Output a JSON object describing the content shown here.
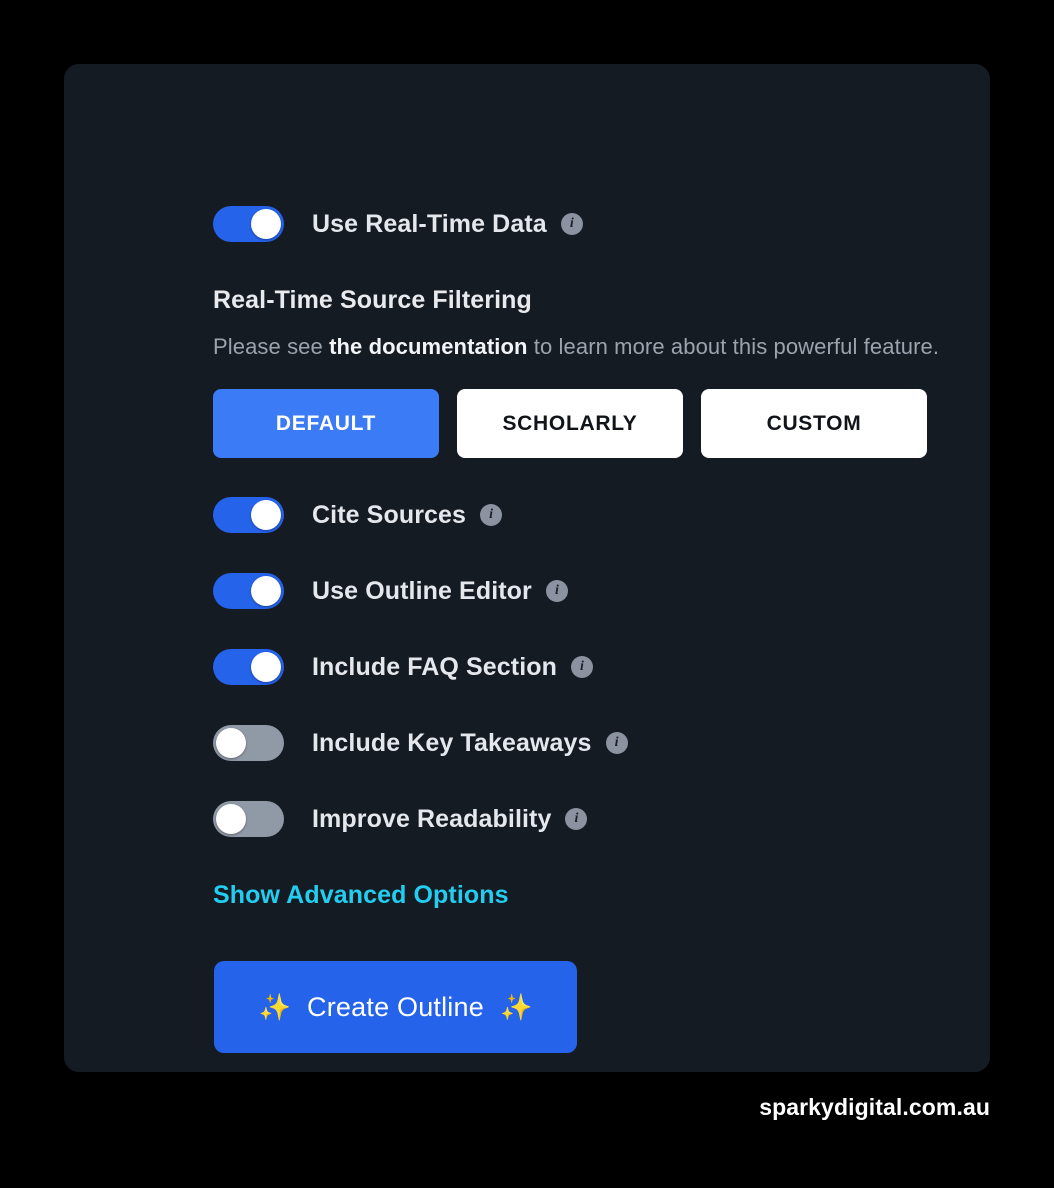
{
  "colors": {
    "page_background": "#000000",
    "card_background": "#141b22",
    "toggle_on": "#2563eb",
    "toggle_off": "#9099a6",
    "preset_active": "#3b7bf6",
    "advanced_link": "#22cdf0",
    "cta_background": "#2563eb",
    "sparkle": "#fbbf24"
  },
  "info_icon_glyph": "i",
  "realtime_toggle": {
    "label": "Use Real-Time Data",
    "state": "on",
    "info_icon": "info-icon"
  },
  "source_filtering": {
    "heading": "Real-Time Source Filtering",
    "description_prefix": "Please see ",
    "description_link": "the documentation",
    "description_suffix": " to learn more about this powerful feature.",
    "presets": [
      {
        "label": "DEFAULT",
        "selected": true
      },
      {
        "label": "SCHOLARLY",
        "selected": false
      },
      {
        "label": "CUSTOM",
        "selected": false
      }
    ]
  },
  "options": [
    {
      "label": "Cite Sources",
      "state": "on",
      "info_icon": "info-icon"
    },
    {
      "label": "Use Outline Editor",
      "state": "on",
      "info_icon": "info-icon"
    },
    {
      "label": "Include FAQ Section",
      "state": "on",
      "info_icon": "info-icon"
    },
    {
      "label": "Include Key Takeaways",
      "state": "off",
      "info_icon": "info-icon"
    },
    {
      "label": "Improve Readability",
      "state": "off",
      "info_icon": "info-icon"
    }
  ],
  "advanced": {
    "label": "Show Advanced Options"
  },
  "cta": {
    "label": "Create Outline",
    "left_sparkle": "✨",
    "right_sparkle": "✨"
  },
  "watermark": {
    "text": "sparkydigital.com.au"
  }
}
